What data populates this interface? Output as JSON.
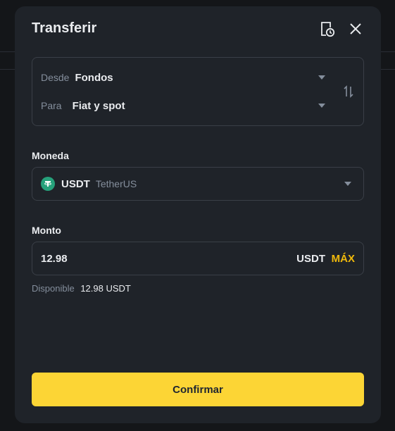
{
  "modal": {
    "title": "Transferir"
  },
  "transfer": {
    "from_label": "Desde",
    "from_value": "Fondos",
    "to_label": "Para",
    "to_value": "Fiat y spot"
  },
  "currency": {
    "section_label": "Moneda",
    "code": "USDT",
    "name": "TetherUS",
    "icon": "tether-icon",
    "icon_color": "#26a17b"
  },
  "amount": {
    "section_label": "Monto",
    "value": "12.98",
    "unit": "USDT",
    "max_label": "MÁX"
  },
  "available": {
    "label": "Disponible",
    "value": "12.98 USDT"
  },
  "confirm_label": "Confirmar",
  "colors": {
    "accent": "#fcd535",
    "max_text": "#f0b90b",
    "background": "#1f2329"
  }
}
